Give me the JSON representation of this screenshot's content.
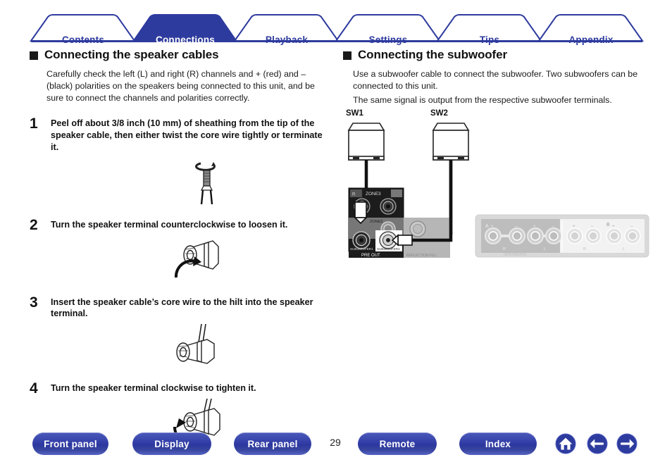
{
  "tabs": [
    {
      "label": "Contents",
      "active": false
    },
    {
      "label": "Connections",
      "active": true
    },
    {
      "label": "Playback",
      "active": false
    },
    {
      "label": "Settings",
      "active": false
    },
    {
      "label": "Tips",
      "active": false
    },
    {
      "label": "Appendix",
      "active": false
    }
  ],
  "left": {
    "heading": "Connecting the speaker cables",
    "intro": "Carefully check the left (L) and right (R) channels and + (red) and – (black) polarities on the speakers being connected to this unit, and be sure to connect the channels and polarities correctly.",
    "steps": [
      {
        "num": "1",
        "text": "Peel off about 3/8 inch (10 mm) of sheathing from the tip of the speaker cable, then either twist the core wire tightly or terminate it.",
        "figure": "speaker-cable-stripped"
      },
      {
        "num": "2",
        "text": "Turn the speaker terminal counterclockwise to loosen it.",
        "figure": "terminal-loosen-ccw"
      },
      {
        "num": "3",
        "text": "Insert the speaker cable’s core wire to the hilt into the speaker terminal.",
        "figure": "terminal-insert-wire"
      },
      {
        "num": "4",
        "text": "Turn the speaker terminal clockwise to tighten it.",
        "figure": "terminal-tighten-cw"
      }
    ]
  },
  "right": {
    "heading": "Connecting the subwoofer",
    "intro1": "Use a subwoofer cable to connect the subwoofer. Two subwoofers can be connected to this unit.",
    "intro2": "The same signal is output from the respective subwoofer terminals.",
    "diagram": {
      "sub1_label": "SW1",
      "sub2_label": "SW2",
      "preout_panel": {
        "zone_label": "ZONE3",
        "zone2_label": "ZONE2",
        "sub1_jack": "SUBWOOFER 1",
        "sub2_jack": "SUBWOOFER 2",
        "group_label": "PRE OUT",
        "side_label": "REFLECTION FILL"
      },
      "speaker_panel": {
        "group_label": "SPEAKERS",
        "zone_a": "A",
        "zone_b": "B",
        "terminal_r": "R",
        "terminal_l": "L",
        "plus": "+",
        "minus": "–"
      }
    }
  },
  "footer": {
    "buttons": [
      {
        "label": "Front panel"
      },
      {
        "label": "Display"
      },
      {
        "label": "Rear panel"
      },
      {
        "label": "Remote"
      },
      {
        "label": "Index"
      }
    ],
    "page_number": "29",
    "nav_icons": [
      {
        "name": "home-icon"
      },
      {
        "name": "back-arrow-icon"
      },
      {
        "name": "forward-arrow-icon"
      }
    ]
  },
  "colors": {
    "accent": "#2e3b9e",
    "tab_active_bg": "#2e3b9e",
    "text": "#1a1a1a"
  }
}
